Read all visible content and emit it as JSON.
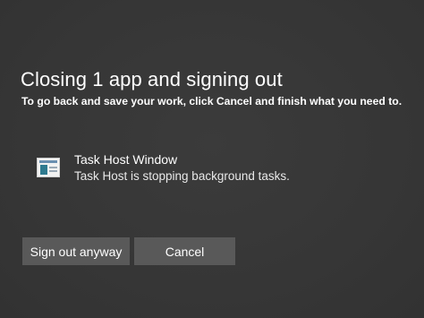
{
  "dialog": {
    "title": "Closing 1 app and signing out",
    "subtitle": "To go back and save your work, click Cancel and finish what you need to."
  },
  "apps": [
    {
      "name": "Task Host Window",
      "status": "Task Host is stopping background tasks.",
      "icon": "task-host-window-icon"
    }
  ],
  "buttons": {
    "sign_out_label": "Sign out anyway",
    "cancel_label": "Cancel"
  },
  "colors": {
    "background": "#373737",
    "button": "#595959",
    "text": "#ffffff"
  }
}
